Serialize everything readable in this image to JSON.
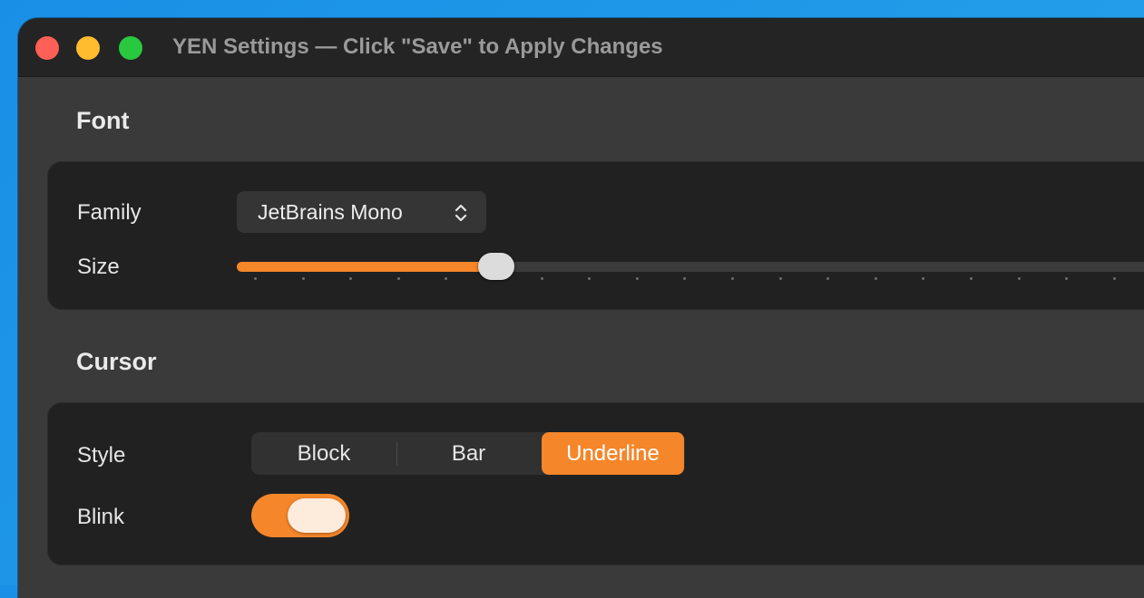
{
  "window": {
    "title": "YEN Settings — Click \"Save\" to Apply Changes"
  },
  "colors": {
    "accent": "#f5862a",
    "traffic_close": "#fe5f57",
    "traffic_minimize": "#febc2e",
    "traffic_maximize": "#28c840",
    "toggle_knob": "#fdebdc"
  },
  "font_section": {
    "title": "Font",
    "family": {
      "label": "Family",
      "value": "JetBrains Mono",
      "icon": "up-down-chevron-icon"
    },
    "size": {
      "label": "Size",
      "fraction": 0.27,
      "tick_count": 19
    }
  },
  "cursor_section": {
    "title": "Cursor",
    "style": {
      "label": "Style",
      "options": [
        "Block",
        "Bar",
        "Underline"
      ],
      "selected": "Underline"
    },
    "blink": {
      "label": "Blink",
      "enabled": true
    }
  }
}
